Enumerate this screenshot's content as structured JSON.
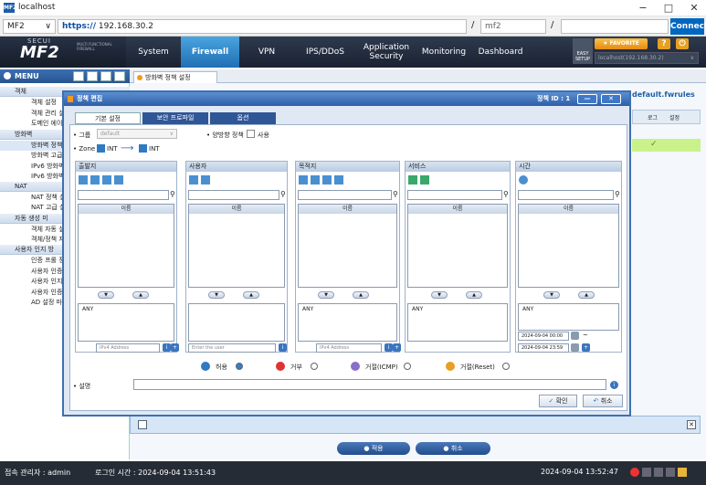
{
  "browser": {
    "title": "localhost",
    "profile": "MF2",
    "scheme": "https://",
    "address": "192.168.30.2",
    "slash1": "/",
    "tabname": "mf2",
    "slash2": "/",
    "connect": "Connect",
    "icon_text": "MF2"
  },
  "logo": {
    "brand": "SECUI",
    "product": "MF2",
    "tagline": "MULTI FUNCTIONAL FIREWALL"
  },
  "nav": {
    "items": [
      "System",
      "Firewall",
      "VPN",
      "IPS/DDoS",
      "Application Security",
      "Monitoring",
      "Dashboard"
    ],
    "active": "Firewall"
  },
  "header": {
    "easy_setup": "EASY SETUP",
    "favorite": "FAVORITE",
    "host": "localhost(192.168.30.2)"
  },
  "menu": {
    "title": "MENU",
    "groups": [
      {
        "label": "객체",
        "items": [
          "객체 설정",
          "객체 관리 설",
          "도메인 에이"
        ]
      },
      {
        "label": "방화벽",
        "items": [
          "방화벽 정책",
          "방화벽 고급",
          "IPv6 방화벽",
          "IPv6 방화벽"
        ]
      },
      {
        "label": "NAT",
        "items": [
          "NAT 정책 설",
          "NAT 고급 설"
        ]
      },
      {
        "label": "자동 생성 미",
        "items": [
          "객체 자동 설",
          "객체/정책 자"
        ]
      },
      {
        "label": "사용자 인지 방",
        "items": [
          "인증 프롤 정",
          "사용자 인증",
          "사용자 인지",
          "사용자 인증",
          "AD 설정 마"
        ]
      }
    ]
  },
  "main": {
    "tab": "방화벽 정책 설정",
    "fwrules": "default.fwrules",
    "col_log": "로그",
    "col_set": "설정",
    "check": "✓"
  },
  "footer": {
    "apply": "적용",
    "cancel": "취소"
  },
  "status": {
    "admin": "접속 관리자 : admin",
    "login_time": "로그인 시간 : 2024-09-04 13:51:43",
    "clock": "2024-09-04 13:52:47"
  },
  "dialog": {
    "title": "정책 편집",
    "policy_id": "정책 ID : 1",
    "tabs": [
      "기본 설정",
      "보안 프로파일",
      "옵션"
    ],
    "group_label": "그룹",
    "group_value": "default",
    "bidir_label": "양방향 정책",
    "bidir_use": "사용",
    "zone_label": "Zone",
    "zone_from": "INT",
    "zone_to": "INT",
    "columns": [
      {
        "title": "출발지",
        "list_header": "이름",
        "entry": "ANY",
        "input": "IPv4 Address"
      },
      {
        "title": "사용자",
        "list_header": "이름",
        "entry": "",
        "input": "Enter the user"
      },
      {
        "title": "목적지",
        "list_header": "이름",
        "entry": "ANY",
        "input": "IPv4 Address"
      },
      {
        "title": "서비스",
        "list_header": "이름",
        "entry": "ANY",
        "input": ""
      },
      {
        "title": "시간",
        "list_header": "이름",
        "entry": "ANY",
        "input": ""
      }
    ],
    "time_from": "2024-09-04 00:00",
    "time_to": "2024-09-04 23:59",
    "tilde": "~",
    "actions": [
      "허용",
      "거부",
      "거절(ICMP)",
      "거절(Reset)"
    ],
    "desc_label": "설명",
    "ok": "확인",
    "cancel": "취소"
  }
}
